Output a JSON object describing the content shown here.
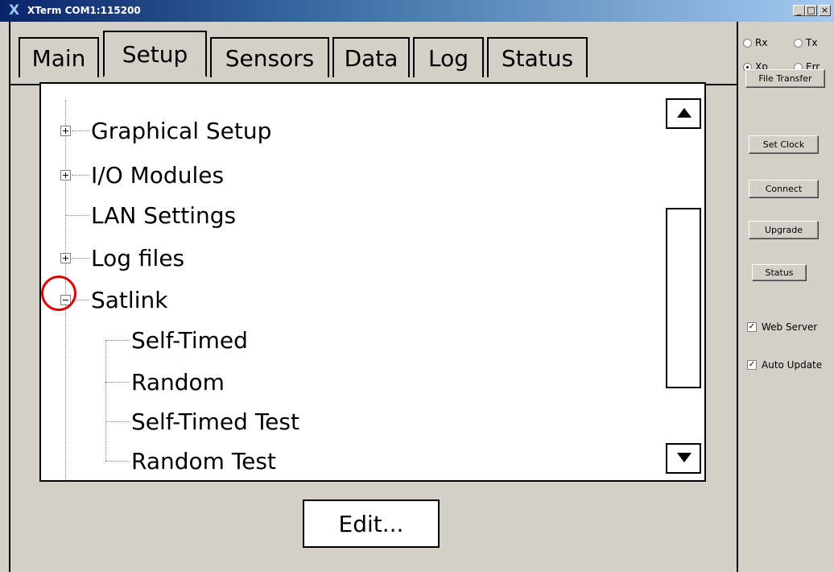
{
  "window": {
    "title": "XTerm COM1:115200",
    "icon": "x-logo-icon",
    "minimize": "_",
    "maximize": "□",
    "close": "×"
  },
  "tabs": [
    {
      "label": "Main",
      "active": false
    },
    {
      "label": "Setup",
      "active": true
    },
    {
      "label": "Sensors",
      "active": false
    },
    {
      "label": "Data",
      "active": false
    },
    {
      "label": "Log",
      "active": false
    },
    {
      "label": "Status",
      "active": false
    }
  ],
  "tree": {
    "items": [
      {
        "label": "Graphical Setup",
        "expander": "plus"
      },
      {
        "label": "I/O Modules",
        "expander": "plus"
      },
      {
        "label": "LAN Settings",
        "expander": "none"
      },
      {
        "label": "Log files",
        "expander": "plus"
      },
      {
        "label": "Satlink",
        "expander": "minus"
      },
      {
        "label": "Self-Timed",
        "expander": "none"
      },
      {
        "label": "Random",
        "expander": "none"
      },
      {
        "label": "Self-Timed Test",
        "expander": "none"
      },
      {
        "label": "Random Test",
        "expander": "none"
      }
    ]
  },
  "edit_button": "Edit...",
  "side": {
    "radios": [
      {
        "label": "Rx",
        "checked": false
      },
      {
        "label": "Tx",
        "checked": false
      },
      {
        "label": "Xp",
        "checked": true
      },
      {
        "label": "Err",
        "checked": false
      }
    ],
    "buttons": {
      "file_transfer": "File Transfer",
      "set_clock": "Set Clock",
      "connect": "Connect",
      "upgrade": "Upgrade",
      "status": "Status"
    },
    "checkboxes": [
      {
        "label": "Web Server",
        "checked": true
      },
      {
        "label": "Auto Update",
        "checked": true
      }
    ],
    "check_mark": "✓"
  },
  "colors": {
    "highlight": "#e00000",
    "titlebar": "#0a246a"
  }
}
